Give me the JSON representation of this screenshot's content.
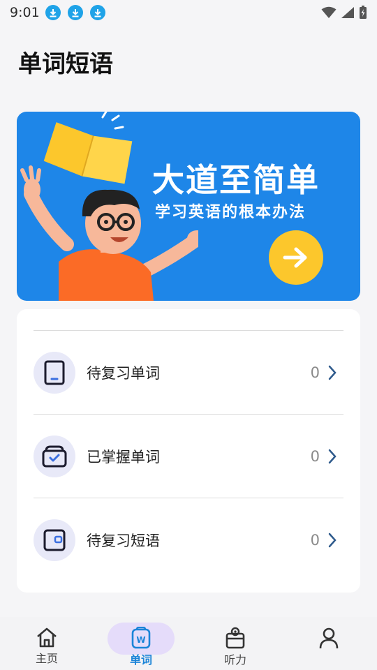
{
  "status_bar": {
    "time": "9:01",
    "notification_icons": [
      "download-icon",
      "download-icon",
      "download-icon"
    ],
    "system_icons": [
      "wifi-icon",
      "signal-icon",
      "battery-icon"
    ]
  },
  "header": {
    "title": "单词短语"
  },
  "banner": {
    "title": "大道至简单",
    "subtitle": "学习英语的根本办法",
    "background_color": "#1e86e8",
    "button_color": "#fcc72c",
    "button_icon": "arrow-right-icon"
  },
  "list": {
    "items": [
      {
        "label": "待复习单词",
        "count": "0",
        "icon": "tablet-icon"
      },
      {
        "label": "已掌握单词",
        "count": "0",
        "icon": "checked-box-icon"
      },
      {
        "label": "待复习短语",
        "count": "0",
        "icon": "phrase-card-icon"
      }
    ]
  },
  "bottom_nav": {
    "items": [
      {
        "label": "主页",
        "icon": "home-icon",
        "active": false
      },
      {
        "label": "单词",
        "icon": "word-icon",
        "active": true
      },
      {
        "label": "听力",
        "icon": "radio-icon",
        "active": false
      },
      {
        "label": "",
        "icon": "profile-icon",
        "active": false
      }
    ],
    "active_color": "#1b84d8",
    "active_pill_color": "#e5dcfa"
  }
}
